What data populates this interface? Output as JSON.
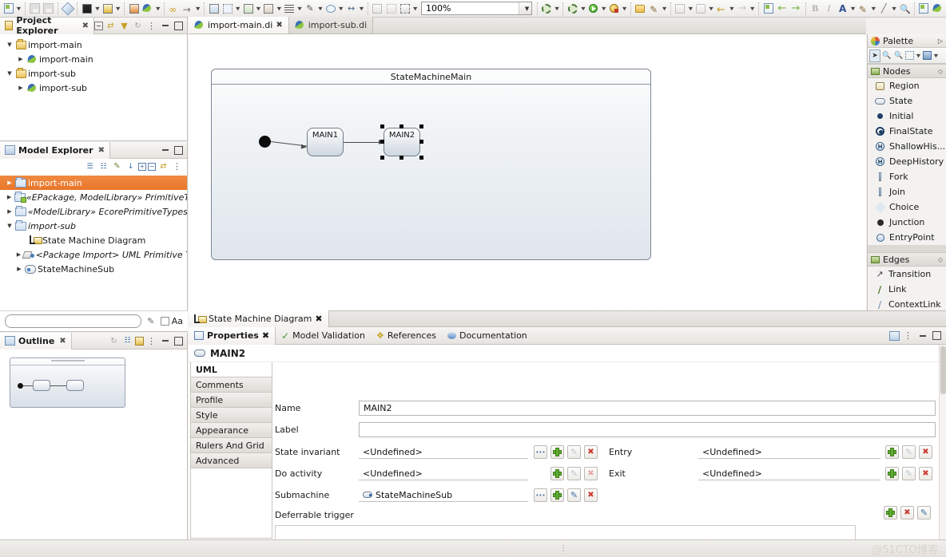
{
  "toolbar": {
    "zoom_value": "100%",
    "icons": [
      "new-file-icon",
      "save-icon",
      "save-all-icon",
      "marker-icon",
      "import-diagram-icon",
      "export-diagram-icon",
      "new-model-icon",
      "papyrus-icon",
      "link-icon",
      "arrow-icon",
      "duplicate-icon",
      "layout-icon",
      "grid-icon",
      "align-icon",
      "hand-icon",
      "route-icon",
      "resize-icon",
      "snap-icon",
      "select-icon",
      "settings-icon",
      "run-icon",
      "debug-icon",
      "open-type-icon",
      "pencil-icon",
      "stamp-icon",
      "history-icon",
      "back-icon",
      "forward-icon",
      "next-annotation-icon",
      "bold-icon",
      "italic-icon",
      "font-color-icon",
      "fill-color-icon",
      "line-color-icon",
      "search-icon",
      "perspective-icon"
    ]
  },
  "project_explorer": {
    "title": "Project Explorer",
    "tools": [
      "collapse-all-icon",
      "link-with-editor-icon",
      "filter-icon",
      "refresh-icon",
      "view-menu-icon",
      "minimize-icon",
      "maximize-icon"
    ],
    "items": [
      {
        "label": "import-main",
        "icon": "folder-icon",
        "indent": 0,
        "twisty": "open"
      },
      {
        "label": "import-main",
        "icon": "papyrus-model-icon",
        "indent": 1,
        "twisty": "closed"
      },
      {
        "label": "import-sub",
        "icon": "folder-icon",
        "indent": 0,
        "twisty": "open"
      },
      {
        "label": "import-sub",
        "icon": "papyrus-model-icon",
        "indent": 1,
        "twisty": "closed"
      }
    ]
  },
  "model_explorer": {
    "title": "Model Explorer",
    "tools": [
      "list-icon",
      "tree-icon",
      "edit-icon",
      "sort-icon",
      "expand-all-icon",
      "collapse-all-icon",
      "link-icon",
      "view-menu-icon"
    ],
    "items": [
      {
        "label": "import-main",
        "icon": "package-icon",
        "indent": 0,
        "twisty": "closed",
        "selected": true,
        "italic": false
      },
      {
        "label": "«EPackage, ModelLibrary» PrimitiveTyp",
        "icon": "package-model-icon",
        "indent": 0,
        "twisty": "closed",
        "selected": false,
        "italic": true
      },
      {
        "label": "«ModelLibrary» EcorePrimitiveTypes",
        "icon": "package-icon",
        "indent": 0,
        "twisty": "closed",
        "selected": false,
        "italic": true
      },
      {
        "label": "import-sub",
        "icon": "package-icon",
        "indent": 0,
        "twisty": "open",
        "selected": false,
        "italic": true
      },
      {
        "label": "State Machine Diagram",
        "icon": "state-machine-diagram-icon",
        "indent": 1,
        "twisty": "none",
        "selected": false,
        "italic": false
      },
      {
        "label": "<Package Import> UML Primitive Typ",
        "icon": "package-import-icon",
        "indent": 1,
        "twisty": "closed",
        "selected": false,
        "italic": true
      },
      {
        "label": "StateMachineSub",
        "icon": "state-machine-icon",
        "indent": 1,
        "twisty": "closed",
        "selected": false,
        "italic": false
      }
    ],
    "search_placeholder": "",
    "search_value": "",
    "case_label": "Aa"
  },
  "outline": {
    "title": "Outline",
    "tools": [
      "refresh-icon",
      "tree-icon",
      "overview-icon",
      "view-menu-icon",
      "minimize-icon",
      "maximize-icon"
    ]
  },
  "editor_tabs": [
    {
      "label": "import-main.di",
      "active": true,
      "icon": "papyrus-icon"
    },
    {
      "label": "import-sub.di",
      "active": false,
      "icon": "papyrus-icon"
    }
  ],
  "diagram": {
    "frame_title": "StateMachineMain",
    "states": [
      {
        "name": "MAIN1",
        "selected": false
      },
      {
        "name": "MAIN2",
        "selected": true
      }
    ],
    "initial_node": "initial-state-node"
  },
  "palette": {
    "title": "Palette",
    "tools": [
      "select-tool-icon",
      "zoom-in-icon",
      "zoom-out-icon",
      "marquee-icon",
      "node-tool-icon"
    ],
    "groups": [
      {
        "name": "Nodes",
        "items": [
          {
            "label": "Region",
            "icon": "region-icon"
          },
          {
            "label": "State",
            "icon": "state-icon"
          },
          {
            "label": "Initial",
            "icon": "initial-icon"
          },
          {
            "label": "FinalState",
            "icon": "final-state-icon"
          },
          {
            "label": "ShallowHis...",
            "icon": "shallow-history-icon"
          },
          {
            "label": "DeepHistory",
            "icon": "deep-history-icon"
          },
          {
            "label": "Fork",
            "icon": "fork-icon"
          },
          {
            "label": "Join",
            "icon": "join-icon"
          },
          {
            "label": "Choice",
            "icon": "choice-icon"
          },
          {
            "label": "Junction",
            "icon": "junction-icon"
          },
          {
            "label": "EntryPoint",
            "icon": "entry-point-icon"
          }
        ]
      },
      {
        "name": "Edges",
        "items": [
          {
            "label": "Transition",
            "icon": "transition-icon"
          },
          {
            "label": "Link",
            "icon": "link-icon"
          },
          {
            "label": "ContextLink",
            "icon": "context-link-icon"
          }
        ]
      }
    ]
  },
  "diagram_view_tab": {
    "label": "State Machine Diagram",
    "icon": "state-machine-diagram-icon"
  },
  "properties": {
    "tabs": [
      {
        "label": "Properties",
        "active": true,
        "icon": "properties-icon"
      },
      {
        "label": "Model Validation",
        "active": false,
        "icon": "checkmark-icon"
      },
      {
        "label": "References",
        "active": false,
        "icon": "references-icon"
      },
      {
        "label": "Documentation",
        "active": false,
        "icon": "documentation-icon"
      }
    ],
    "tools": [
      "new-view-icon",
      "view-menu-icon",
      "minimize-icon",
      "maximize-icon"
    ],
    "selected_element": "MAIN2",
    "side_tabs": [
      {
        "label": "UML",
        "active": true
      },
      {
        "label": "Comments",
        "active": false
      },
      {
        "label": "Profile",
        "active": false
      },
      {
        "label": "Style",
        "active": false
      },
      {
        "label": "Appearance",
        "active": false
      },
      {
        "label": "Rulers And Grid",
        "active": false
      },
      {
        "label": "Advanced",
        "active": false
      }
    ],
    "fields": {
      "name_label": "Name",
      "name_value": "MAIN2",
      "label_label": "Label",
      "label_value": "",
      "state_invariant_label": "State invariant",
      "state_invariant_value": "<Undefined>",
      "do_activity_label": "Do activity",
      "do_activity_value": "<Undefined>",
      "submachine_label": "Submachine",
      "submachine_value": "StateMachineSub",
      "deferrable_trigger_label": "Deferrable trigger",
      "entry_label": "Entry",
      "entry_value": "<Undefined>",
      "exit_label": "Exit",
      "exit_value": "<Undefined>"
    }
  },
  "statusbar": {
    "watermark": "@51CTO博客"
  }
}
